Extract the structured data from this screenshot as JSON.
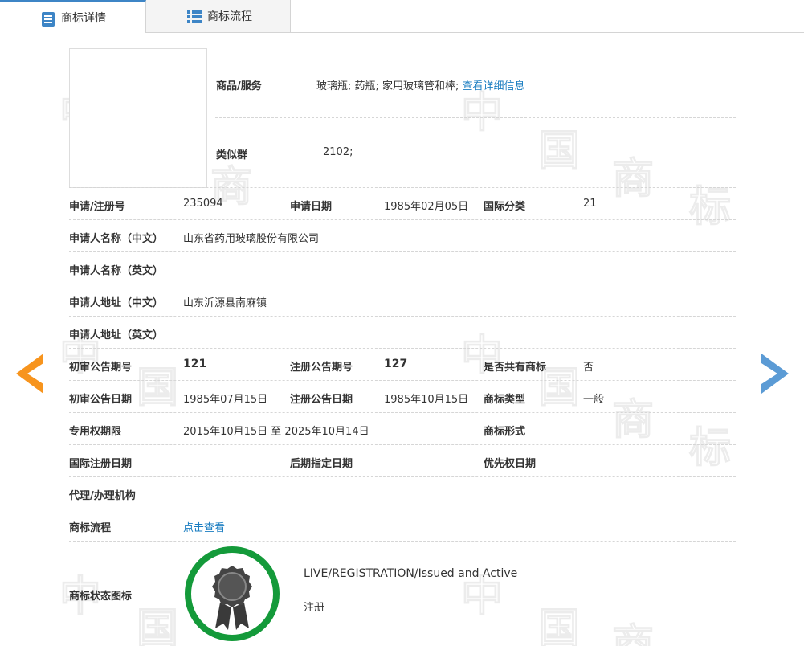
{
  "tabs": [
    {
      "label": "商标详情",
      "active": true
    },
    {
      "label": "商标流程",
      "active": false
    }
  ],
  "watermark": [
    "中",
    "国",
    "商",
    "标"
  ],
  "goods": {
    "label": "商品/服务",
    "value": "玻璃瓶; 药瓶; 家用玻璃管和棒;",
    "link": "查看详细信息"
  },
  "similar_group": {
    "label": "类似群",
    "value": "2102;"
  },
  "rows": {
    "reg_no": {
      "label": "申请/注册号",
      "value": "235094"
    },
    "app_date": {
      "label": "申请日期",
      "value": "1985年02月05日"
    },
    "intl_class": {
      "label": "国际分类",
      "value": "21"
    },
    "applicant_cn": {
      "label": "申请人名称（中文）",
      "value": "山东省药用玻璃股份有限公司"
    },
    "applicant_en": {
      "label": "申请人名称（英文）",
      "value": ""
    },
    "address_cn": {
      "label": "申请人地址（中文）",
      "value": "山东沂源县南麻镇"
    },
    "address_en": {
      "label": "申请人地址（英文）",
      "value": ""
    },
    "prelim_no": {
      "label": "初审公告期号",
      "value": "121"
    },
    "reg_pub_no": {
      "label": "注册公告期号",
      "value": "127"
    },
    "shared": {
      "label": "是否共有商标",
      "value": "否"
    },
    "prelim_date": {
      "label": "初审公告日期",
      "value": "1985年07月15日"
    },
    "reg_pub_date": {
      "label": "注册公告日期",
      "value": "1985年10月15日"
    },
    "mark_type": {
      "label": "商标类型",
      "value": "一般"
    },
    "exclusive": {
      "label": "专用权期限",
      "value": "2015年10月15日 至 2025年10月14日"
    },
    "mark_form": {
      "label": "商标形式",
      "value": ""
    },
    "intl_reg_date": {
      "label": "国际注册日期",
      "value": ""
    },
    "later_date": {
      "label": "后期指定日期",
      "value": ""
    },
    "priority_date": {
      "label": "优先权日期",
      "value": ""
    },
    "agent": {
      "label": "代理/办理机构",
      "value": ""
    },
    "process": {
      "label": "商标流程",
      "link": "点击查看"
    },
    "status": {
      "label": "商标状态图标",
      "en": "LIVE/REGISTRATION/Issued and Active",
      "cn": "注册"
    }
  },
  "colors": {
    "link": "#1a7dc1",
    "accent_blue": "#3d85c6",
    "prev_arrow": "#f7941d",
    "next_arrow": "#5b9bd5",
    "status_ring": "#149a3a"
  },
  "icons": {
    "tab_detail": "document-list-icon",
    "tab_flow": "list-icon",
    "prev": "arrow-left-icon",
    "next": "arrow-right-icon",
    "status": "award-ribbon-icon"
  }
}
